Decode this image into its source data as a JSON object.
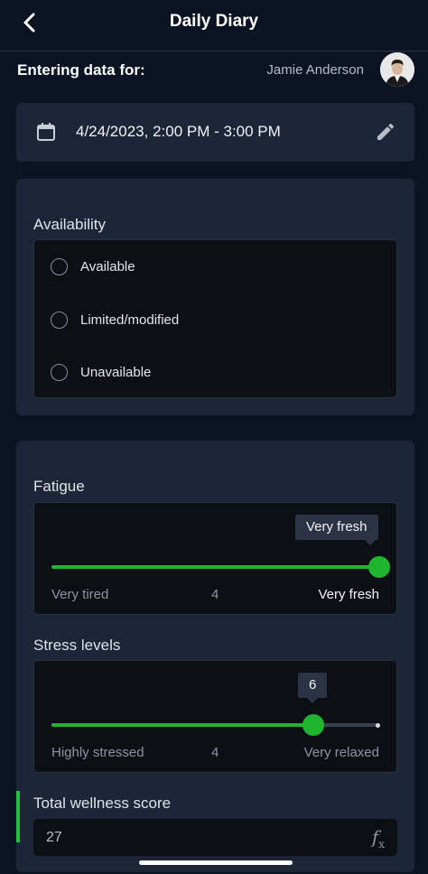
{
  "header": {
    "title": "Daily Diary",
    "back_icon": "chevron-left-icon"
  },
  "entering": {
    "label": "Entering data for:",
    "user_name": "Jamie Anderson"
  },
  "date": {
    "value": "4/24/2023, 2:00 PM - 3:00 PM",
    "calendar_icon": "calendar-icon",
    "edit_icon": "pencil-icon"
  },
  "availability": {
    "label": "Availability",
    "options": [
      "Available",
      "Limited/modified",
      "Unavailable"
    ],
    "selected": null
  },
  "fatigue": {
    "label": "Fatigue",
    "tooltip": "Very fresh",
    "min_label": "Very tired",
    "mid_label": "4",
    "max_label": "Very fresh",
    "level_fraction": 1.0
  },
  "stress": {
    "label": "Stress levels",
    "tooltip": "6",
    "min_label": "Highly stressed",
    "mid_label": "4",
    "max_label": "Very relaxed",
    "level_fraction": 0.8
  },
  "total": {
    "label": "Total wellness score",
    "value": "27",
    "formula_icon": "fx-icon"
  },
  "colors": {
    "background": "#0c1322",
    "card": "#1c2638",
    "accent": "#1fb52e"
  }
}
